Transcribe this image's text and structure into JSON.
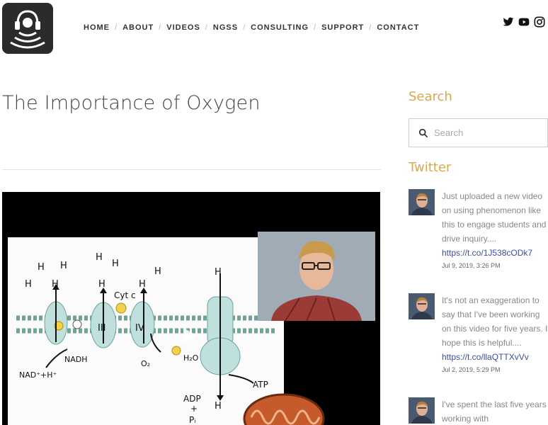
{
  "nav": {
    "items": [
      "HOME",
      "ABOUT",
      "VIDEOS",
      "NGSS",
      "CONSULTING",
      "SUPPORT",
      "CONTACT"
    ],
    "separator": "/"
  },
  "social": [
    "twitter-icon",
    "youtube-icon",
    "instagram-icon"
  ],
  "page": {
    "title": "The Importance of Oxygen"
  },
  "video": {
    "labels": {
      "h_plus": "H",
      "cyt_c": "Cyt c",
      "complex_iii": "III",
      "complex_iv": "IV",
      "nadh": "NADH",
      "nad_h": "NAD⁺+H⁺",
      "o2": "O₂",
      "h2o": "H₂O",
      "atp": "ATP",
      "adp": "ADP",
      "plus": "+",
      "pi": "Pᵢ"
    }
  },
  "sidebar": {
    "search_heading": "Search",
    "search_placeholder": "Search",
    "twitter_heading": "Twitter",
    "tweets": [
      {
        "text": "Just uploaded a new video on using phenomenon like this to engage students and drive inquiry....",
        "link": "https://t.co/1J538cODk7",
        "date": "Jul 9, 2019, 3:26 PM"
      },
      {
        "text": "It's not an exaggeration to say that I've been working on this video for five years. I hope this is helpful....",
        "link": "https://t.co/llaQTTXvVv",
        "date": "Jul 2, 2019, 5:29 PM"
      },
      {
        "text": "I've spent the last five years working with",
        "link": "",
        "date": ""
      }
    ]
  },
  "colors": {
    "accent": "#d9a94f",
    "link": "#3b4ea0",
    "nav_text": "#333333"
  }
}
